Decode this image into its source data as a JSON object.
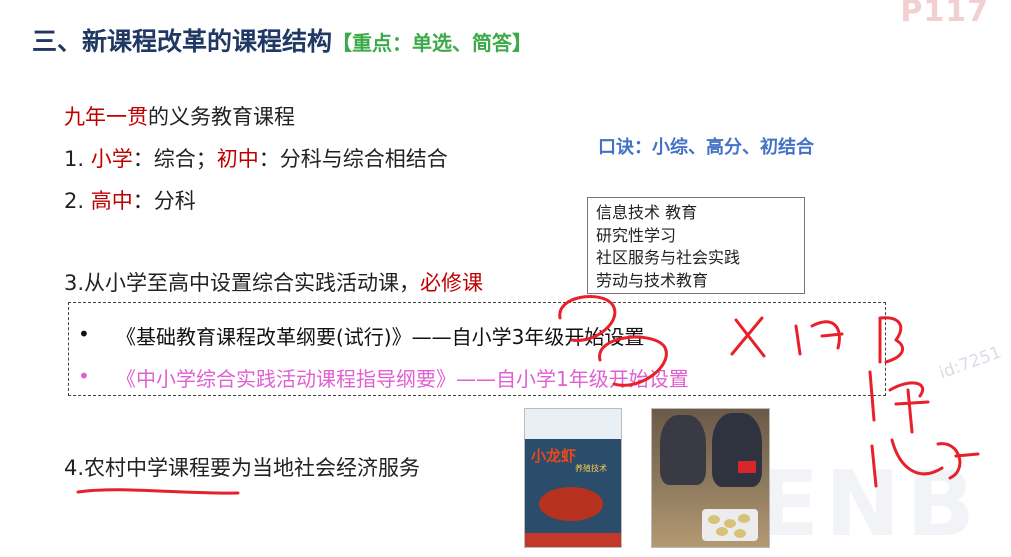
{
  "header": {
    "title": "三、新课程改革的课程结构",
    "tag": "【重点：单选、简答】",
    "page_number": "P117"
  },
  "intro": {
    "highlight": "九年一贯",
    "rest": "的义务教育课程"
  },
  "items": [
    {
      "num": "1. ",
      "a_label": "小学",
      "a_text": "：综合；",
      "b_label": "初中",
      "b_text": "：分科与综合相结合"
    },
    {
      "num": "2. ",
      "a_label": "高中",
      "a_text": "：分科"
    }
  ],
  "mnemonic": "口诀：小综、高分、初结合",
  "side_box": [
    "信息技术 教育",
    "研究性学习",
    "社区服务与社会实践",
    "劳动与技术教育"
  ],
  "item3": {
    "text": "3.从小学至高中设置综合实践活动课，",
    "required": "必修课"
  },
  "bullets": [
    {
      "text": "《基础教育课程改革纲要(试行)》——自小学3年级开始设置",
      "color": "#111111"
    },
    {
      "text": "《中小学综合实践活动课程指导纲要》——自小学1年级开始设置",
      "color": "#e05fd2"
    }
  ],
  "item4": "4.农村中学课程要为当地社会经济服务",
  "book": {
    "title": "小龙虾",
    "subtitle": "养殖技术"
  },
  "watermark": "id:7251",
  "bg_watermark": "FENB",
  "handwriting": {
    "note1": "X ·1旧",
    "note2": "1年",
    "note3": "1课时",
    "color": "#e8202a"
  }
}
